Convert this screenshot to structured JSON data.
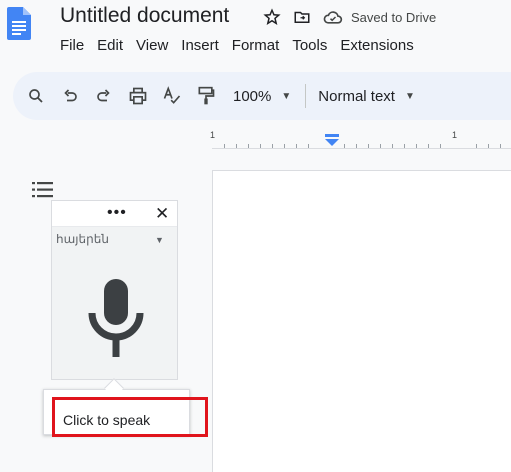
{
  "document": {
    "title": "Untitled document",
    "saved_status": "Saved to Drive"
  },
  "menu": [
    "File",
    "Edit",
    "View",
    "Insert",
    "Format",
    "Tools",
    "Extensions"
  ],
  "toolbar": {
    "zoom": "100%",
    "style": "Normal text"
  },
  "ruler": {
    "label_left": "1",
    "label_right": "1"
  },
  "voice_typing": {
    "more_label": "•••",
    "close_label": "✕",
    "language": "հայերեն",
    "tooltip": "Click to speak"
  },
  "colors": {
    "brand_blue": "#4285f4",
    "toolbar_bg": "#edf2fa",
    "highlight_red": "#e0141c"
  }
}
